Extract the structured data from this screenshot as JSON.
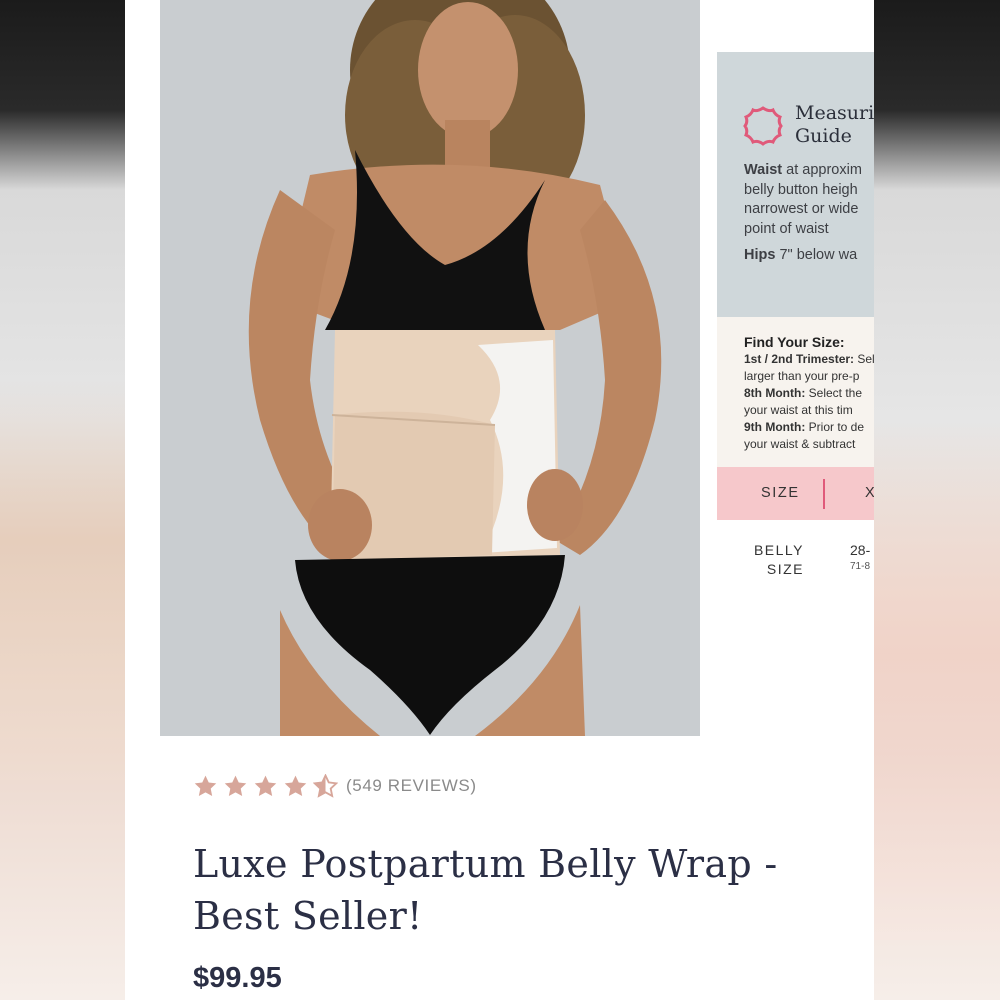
{
  "product": {
    "title": "Luxe Postpartum Belly Wrap - Best Seller!",
    "price": "$99.95",
    "rating": 4.5,
    "rating_max": 5,
    "reviews_text": "(549 REVIEWS)"
  },
  "colors": {
    "star": "#d7a69a",
    "accent_pink": "#e05a7a",
    "guide_blue": "#cfd7da",
    "band_pink": "#f6c8cb"
  },
  "guide": {
    "title_line1": "Measurin",
    "title_line2": "Guide",
    "icon": "flower-badge-icon",
    "waist_label": "Waist",
    "waist_lines": [
      " at approxim",
      "belly button heigh",
      "narrowest or wide",
      "point of waist"
    ],
    "hips_label": "Hips",
    "hips_text": " 7\" below wa",
    "find_title": "Find Your Size:",
    "rows": [
      {
        "label": "1st / 2nd Trimester:",
        "text": " Sel"
      },
      {
        "label": "",
        "text": "larger than your pre-p"
      },
      {
        "label": "8th Month:",
        "text": " Select the"
      },
      {
        "label": "",
        "text": "your waist at this tim"
      },
      {
        "label": "9th Month:",
        "text": " Prior to de"
      },
      {
        "label": "",
        "text": "your waist & subtract"
      }
    ],
    "size_header": "SIZE",
    "size_col": "X",
    "belly_label_1": "BELLY",
    "belly_label_2": "SIZE",
    "belly_value": "28-",
    "belly_sub": "71-8"
  }
}
